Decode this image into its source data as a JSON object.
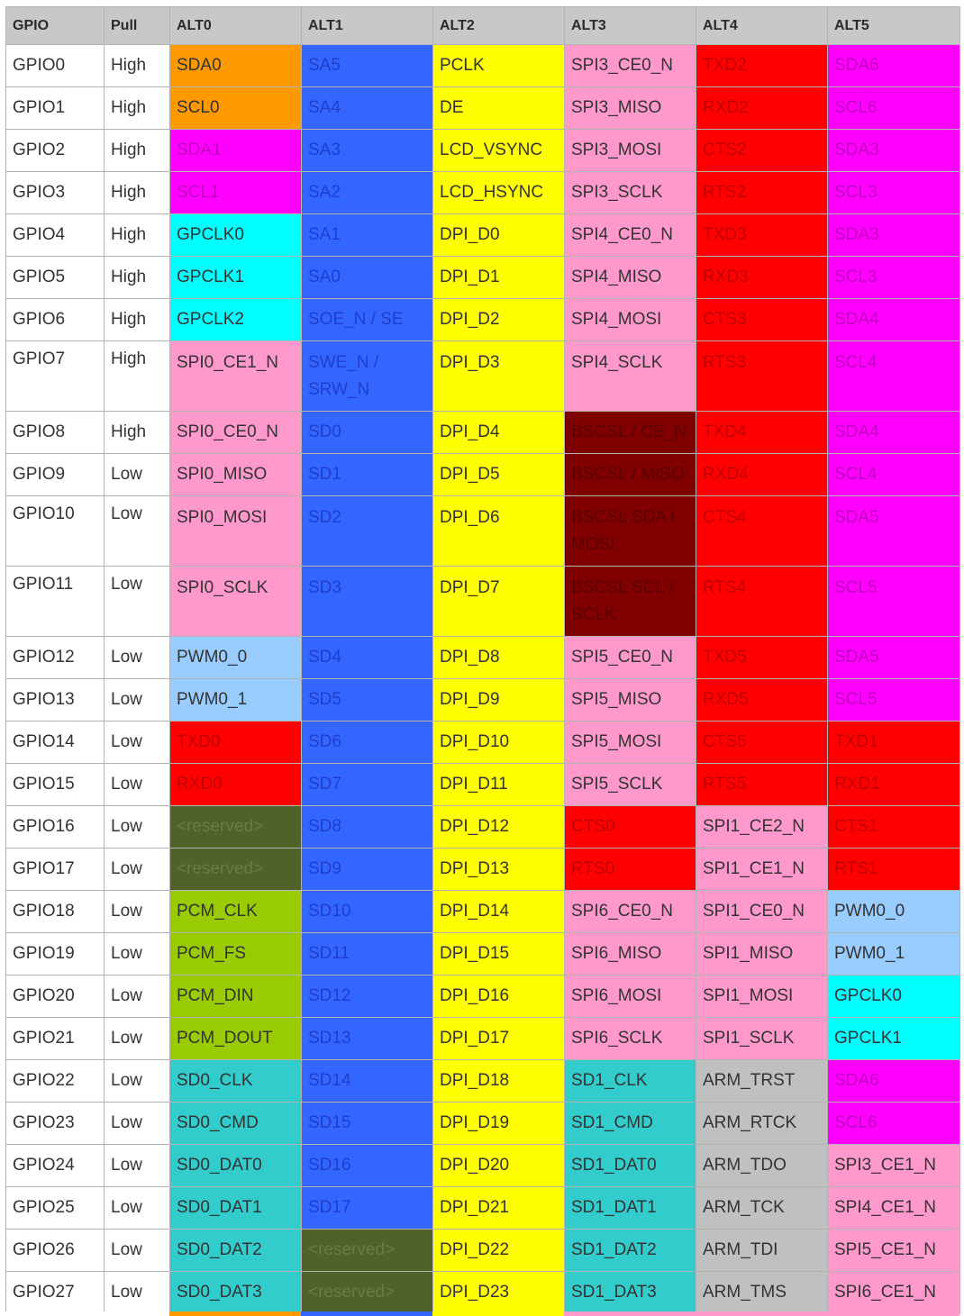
{
  "colors": {
    "orange": "#ff9900",
    "blue": "#3366ff",
    "yellow": "#ffff00",
    "pink": "#ff99cc",
    "red": "#ff0000",
    "magenta": "#ff00ff",
    "cyan": "#00ffff",
    "maroon": "#800000",
    "lightblue": "#99ccff",
    "olive": "#4f6228",
    "green": "#99cc00",
    "teal": "#33cccc",
    "grey": "#c0c0c0",
    "white": "#ffffff"
  },
  "table": {
    "headers": [
      "GPIO",
      "Pull",
      "ALT0",
      "ALT1",
      "ALT2",
      "ALT3",
      "ALT4",
      "ALT5"
    ],
    "rows": [
      {
        "gpio": "GPIO0",
        "pull": "High",
        "cells": [
          {
            "text": "SDA0",
            "color": "orange"
          },
          {
            "text": "SA5",
            "color": "blue"
          },
          {
            "text": "PCLK",
            "color": "yellow"
          },
          {
            "text": "SPI3_CE0_N",
            "color": "pink"
          },
          {
            "text": "TXD2",
            "color": "red"
          },
          {
            "text": "SDA6",
            "color": "magenta"
          }
        ]
      },
      {
        "gpio": "GPIO1",
        "pull": "High",
        "cells": [
          {
            "text": "SCL0",
            "color": "orange"
          },
          {
            "text": "SA4",
            "color": "blue"
          },
          {
            "text": "DE",
            "color": "yellow"
          },
          {
            "text": "SPI3_MISO",
            "color": "pink"
          },
          {
            "text": "RXD2",
            "color": "red"
          },
          {
            "text": "SCL6",
            "color": "magenta"
          }
        ]
      },
      {
        "gpio": "GPIO2",
        "pull": "High",
        "cells": [
          {
            "text": "SDA1",
            "color": "magenta"
          },
          {
            "text": "SA3",
            "color": "blue"
          },
          {
            "text": "LCD_VSYNC",
            "color": "yellow"
          },
          {
            "text": "SPI3_MOSI",
            "color": "pink"
          },
          {
            "text": "CTS2",
            "color": "red"
          },
          {
            "text": "SDA3",
            "color": "magenta"
          }
        ]
      },
      {
        "gpio": "GPIO3",
        "pull": "High",
        "cells": [
          {
            "text": "SCL1",
            "color": "magenta"
          },
          {
            "text": "SA2",
            "color": "blue"
          },
          {
            "text": "LCD_HSYNC",
            "color": "yellow"
          },
          {
            "text": "SPI3_SCLK",
            "color": "pink"
          },
          {
            "text": "RTS2",
            "color": "red"
          },
          {
            "text": "SCL3",
            "color": "magenta"
          }
        ]
      },
      {
        "gpio": "GPIO4",
        "pull": "High",
        "cells": [
          {
            "text": "GPCLK0",
            "color": "cyan"
          },
          {
            "text": "SA1",
            "color": "blue"
          },
          {
            "text": "DPI_D0",
            "color": "yellow"
          },
          {
            "text": "SPI4_CE0_N",
            "color": "pink"
          },
          {
            "text": "TXD3",
            "color": "red"
          },
          {
            "text": "SDA3",
            "color": "magenta"
          }
        ]
      },
      {
        "gpio": "GPIO5",
        "pull": "High",
        "cells": [
          {
            "text": "GPCLK1",
            "color": "cyan"
          },
          {
            "text": "SA0",
            "color": "blue"
          },
          {
            "text": "DPI_D1",
            "color": "yellow"
          },
          {
            "text": "SPI4_MISO",
            "color": "pink"
          },
          {
            "text": "RXD3",
            "color": "red"
          },
          {
            "text": "SCL3",
            "color": "magenta"
          }
        ]
      },
      {
        "gpio": "GPIO6",
        "pull": "High",
        "cells": [
          {
            "text": "GPCLK2",
            "color": "cyan"
          },
          {
            "text": "SOE_N / SE",
            "color": "blue"
          },
          {
            "text": "DPI_D2",
            "color": "yellow"
          },
          {
            "text": "SPI4_MOSI",
            "color": "pink"
          },
          {
            "text": "CTS3",
            "color": "red"
          },
          {
            "text": "SDA4",
            "color": "magenta"
          }
        ]
      },
      {
        "gpio": "GPIO7",
        "pull": "High",
        "tall": true,
        "cells": [
          {
            "text": "SPI0_CE1_N",
            "color": "pink"
          },
          {
            "text": "SWE_N / SRW_N",
            "color": "blue"
          },
          {
            "text": "DPI_D3",
            "color": "yellow"
          },
          {
            "text": "SPI4_SCLK",
            "color": "pink"
          },
          {
            "text": "RTS3",
            "color": "red"
          },
          {
            "text": "SCL4",
            "color": "magenta"
          }
        ]
      },
      {
        "gpio": "GPIO8",
        "pull": "High",
        "cells": [
          {
            "text": "SPI0_CE0_N",
            "color": "pink"
          },
          {
            "text": "SD0",
            "color": "blue"
          },
          {
            "text": "DPI_D4",
            "color": "yellow"
          },
          {
            "text": "BSCSL / CE_N",
            "color": "maroon"
          },
          {
            "text": "TXD4",
            "color": "red"
          },
          {
            "text": "SDA4",
            "color": "magenta"
          }
        ]
      },
      {
        "gpio": "GPIO9",
        "pull": "Low",
        "cells": [
          {
            "text": "SPI0_MISO",
            "color": "pink"
          },
          {
            "text": "SD1",
            "color": "blue"
          },
          {
            "text": "DPI_D5",
            "color": "yellow"
          },
          {
            "text": "BSCSL / MISO",
            "color": "maroon"
          },
          {
            "text": "RXD4",
            "color": "red"
          },
          {
            "text": "SCL4",
            "color": "magenta"
          }
        ]
      },
      {
        "gpio": "GPIO10",
        "pull": "Low",
        "tall": true,
        "cells": [
          {
            "text": "SPI0_MOSI",
            "color": "pink"
          },
          {
            "text": "SD2",
            "color": "blue"
          },
          {
            "text": "DPI_D6",
            "color": "yellow"
          },
          {
            "text": "BSCSL SDA / MOSI",
            "color": "maroon"
          },
          {
            "text": "CTS4",
            "color": "red"
          },
          {
            "text": "SDA5",
            "color": "magenta"
          }
        ]
      },
      {
        "gpio": "GPIO11",
        "pull": "Low",
        "tall": true,
        "cells": [
          {
            "text": "SPI0_SCLK",
            "color": "pink"
          },
          {
            "text": "SD3",
            "color": "blue"
          },
          {
            "text": "DPI_D7",
            "color": "yellow"
          },
          {
            "text": "BSCSL SCL / SCLK",
            "color": "maroon"
          },
          {
            "text": "RTS4",
            "color": "red"
          },
          {
            "text": "SCL5",
            "color": "magenta"
          }
        ]
      },
      {
        "gpio": "GPIO12",
        "pull": "Low",
        "cells": [
          {
            "text": "PWM0_0",
            "color": "lightblue"
          },
          {
            "text": "SD4",
            "color": "blue"
          },
          {
            "text": "DPI_D8",
            "color": "yellow"
          },
          {
            "text": "SPI5_CE0_N",
            "color": "pink"
          },
          {
            "text": "TXD5",
            "color": "red"
          },
          {
            "text": "SDA5",
            "color": "magenta"
          }
        ]
      },
      {
        "gpio": "GPIO13",
        "pull": "Low",
        "cells": [
          {
            "text": "PWM0_1",
            "color": "lightblue"
          },
          {
            "text": "SD5",
            "color": "blue"
          },
          {
            "text": "DPI_D9",
            "color": "yellow"
          },
          {
            "text": "SPI5_MISO",
            "color": "pink"
          },
          {
            "text": "RXD5",
            "color": "red"
          },
          {
            "text": "SCL5",
            "color": "magenta"
          }
        ]
      },
      {
        "gpio": "GPIO14",
        "pull": "Low",
        "cells": [
          {
            "text": "TXD0",
            "color": "red"
          },
          {
            "text": "SD6",
            "color": "blue"
          },
          {
            "text": "DPI_D10",
            "color": "yellow"
          },
          {
            "text": "SPI5_MOSI",
            "color": "pink"
          },
          {
            "text": "CTS5",
            "color": "red"
          },
          {
            "text": "TXD1",
            "color": "red"
          }
        ]
      },
      {
        "gpio": "GPIO15",
        "pull": "Low",
        "cells": [
          {
            "text": "RXD0",
            "color": "red"
          },
          {
            "text": "SD7",
            "color": "blue"
          },
          {
            "text": "DPI_D11",
            "color": "yellow"
          },
          {
            "text": "SPI5_SCLK",
            "color": "pink"
          },
          {
            "text": "RTS5",
            "color": "red"
          },
          {
            "text": "RXD1",
            "color": "red"
          }
        ]
      },
      {
        "gpio": "GPIO16",
        "pull": "Low",
        "cells": [
          {
            "text": "<reserved>",
            "color": "olive"
          },
          {
            "text": "SD8",
            "color": "blue"
          },
          {
            "text": "DPI_D12",
            "color": "yellow"
          },
          {
            "text": "CTS0",
            "color": "red"
          },
          {
            "text": "SPI1_CE2_N",
            "color": "pink"
          },
          {
            "text": "CTS1",
            "color": "red"
          }
        ]
      },
      {
        "gpio": "GPIO17",
        "pull": "Low",
        "cells": [
          {
            "text": "<reserved>",
            "color": "olive"
          },
          {
            "text": "SD9",
            "color": "blue"
          },
          {
            "text": "DPI_D13",
            "color": "yellow"
          },
          {
            "text": "RTS0",
            "color": "red"
          },
          {
            "text": "SPI1_CE1_N",
            "color": "pink"
          },
          {
            "text": "RTS1",
            "color": "red"
          }
        ]
      },
      {
        "gpio": "GPIO18",
        "pull": "Low",
        "cells": [
          {
            "text": "PCM_CLK",
            "color": "green"
          },
          {
            "text": "SD10",
            "color": "blue"
          },
          {
            "text": "DPI_D14",
            "color": "yellow"
          },
          {
            "text": "SPI6_CE0_N",
            "color": "pink"
          },
          {
            "text": "SPI1_CE0_N",
            "color": "pink"
          },
          {
            "text": "PWM0_0",
            "color": "lightblue"
          }
        ]
      },
      {
        "gpio": "GPIO19",
        "pull": "Low",
        "cells": [
          {
            "text": "PCM_FS",
            "color": "green"
          },
          {
            "text": "SD11",
            "color": "blue"
          },
          {
            "text": "DPI_D15",
            "color": "yellow"
          },
          {
            "text": "SPI6_MISO",
            "color": "pink"
          },
          {
            "text": "SPI1_MISO",
            "color": "pink"
          },
          {
            "text": "PWM0_1",
            "color": "lightblue"
          }
        ]
      },
      {
        "gpio": "GPIO20",
        "pull": "Low",
        "cells": [
          {
            "text": "PCM_DIN",
            "color": "green"
          },
          {
            "text": "SD12",
            "color": "blue"
          },
          {
            "text": "DPI_D16",
            "color": "yellow"
          },
          {
            "text": "SPI6_MOSI",
            "color": "pink"
          },
          {
            "text": "SPI1_MOSI",
            "color": "pink"
          },
          {
            "text": "GPCLK0",
            "color": "cyan"
          }
        ]
      },
      {
        "gpio": "GPIO21",
        "pull": "Low",
        "cells": [
          {
            "text": "PCM_DOUT",
            "color": "green"
          },
          {
            "text": "SD13",
            "color": "blue"
          },
          {
            "text": "DPI_D17",
            "color": "yellow"
          },
          {
            "text": "SPI6_SCLK",
            "color": "pink"
          },
          {
            "text": "SPI1_SCLK",
            "color": "pink"
          },
          {
            "text": "GPCLK1",
            "color": "cyan"
          }
        ]
      },
      {
        "gpio": "GPIO22",
        "pull": "Low",
        "cells": [
          {
            "text": "SD0_CLK",
            "color": "teal"
          },
          {
            "text": "SD14",
            "color": "blue"
          },
          {
            "text": "DPI_D18",
            "color": "yellow"
          },
          {
            "text": "SD1_CLK",
            "color": "teal"
          },
          {
            "text": "ARM_TRST",
            "color": "grey"
          },
          {
            "text": "SDA6",
            "color": "magenta"
          }
        ]
      },
      {
        "gpio": "GPIO23",
        "pull": "Low",
        "cells": [
          {
            "text": "SD0_CMD",
            "color": "teal"
          },
          {
            "text": "SD15",
            "color": "blue"
          },
          {
            "text": "DPI_D19",
            "color": "yellow"
          },
          {
            "text": "SD1_CMD",
            "color": "teal"
          },
          {
            "text": "ARM_RTCK",
            "color": "grey"
          },
          {
            "text": "SCL6",
            "color": "magenta"
          }
        ]
      },
      {
        "gpio": "GPIO24",
        "pull": "Low",
        "cells": [
          {
            "text": "SD0_DAT0",
            "color": "teal"
          },
          {
            "text": "SD16",
            "color": "blue"
          },
          {
            "text": "DPI_D20",
            "color": "yellow"
          },
          {
            "text": "SD1_DAT0",
            "color": "teal"
          },
          {
            "text": "ARM_TDO",
            "color": "grey"
          },
          {
            "text": "SPI3_CE1_N",
            "color": "pink"
          }
        ]
      },
      {
        "gpio": "GPIO25",
        "pull": "Low",
        "cells": [
          {
            "text": "SD0_DAT1",
            "color": "teal"
          },
          {
            "text": "SD17",
            "color": "blue"
          },
          {
            "text": "DPI_D21",
            "color": "yellow"
          },
          {
            "text": "SD1_DAT1",
            "color": "teal"
          },
          {
            "text": "ARM_TCK",
            "color": "grey"
          },
          {
            "text": "SPI4_CE1_N",
            "color": "pink"
          }
        ]
      },
      {
        "gpio": "GPIO26",
        "pull": "Low",
        "cells": [
          {
            "text": "SD0_DAT2",
            "color": "teal"
          },
          {
            "text": "<reserved>",
            "color": "olive"
          },
          {
            "text": "DPI_D22",
            "color": "yellow"
          },
          {
            "text": "SD1_DAT2",
            "color": "teal"
          },
          {
            "text": "ARM_TDI",
            "color": "grey"
          },
          {
            "text": "SPI5_CE1_N",
            "color": "pink"
          }
        ]
      },
      {
        "gpio": "GPIO27",
        "pull": "Low",
        "cells": [
          {
            "text": "SD0_DAT3",
            "color": "teal"
          },
          {
            "text": "<reserved>",
            "color": "olive"
          },
          {
            "text": "DPI_D23",
            "color": "yellow"
          },
          {
            "text": "SD1_DAT3",
            "color": "teal"
          },
          {
            "text": "ARM_TMS",
            "color": "grey"
          },
          {
            "text": "SPI6_CE1_N",
            "color": "pink"
          }
        ]
      }
    ],
    "trailing_strip_colors": [
      "white",
      "white",
      "orange",
      "blue",
      "yellow",
      "pink",
      "pink",
      "pink"
    ]
  }
}
